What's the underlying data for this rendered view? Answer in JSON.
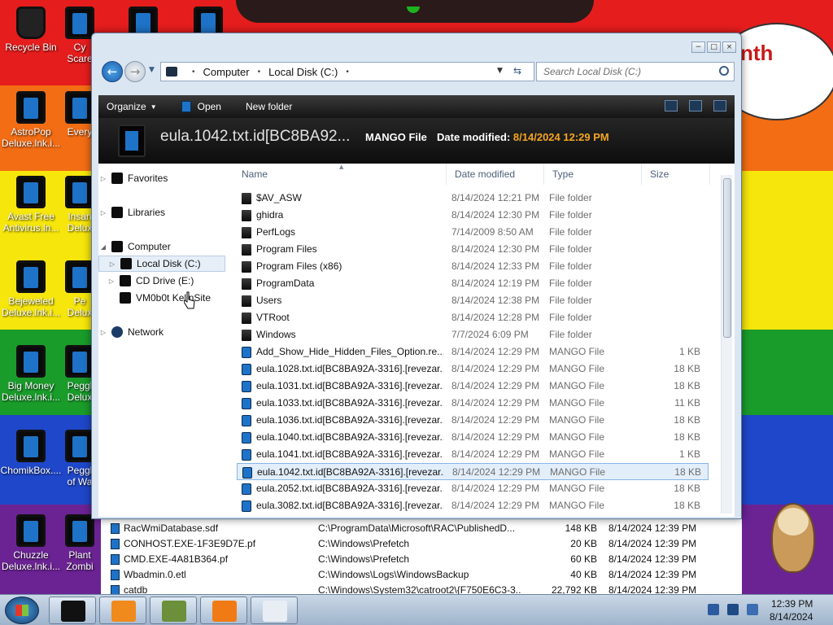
{
  "desktop": {
    "speech_text": "nth",
    "icons": [
      {
        "label": "Recycle Bin"
      },
      {
        "label": "AstroPop Deluxe.lnk.i..."
      },
      {
        "label": "Avast Free Antivirus.ln..."
      },
      {
        "label": "Bejeweled Deluxe.lnk.i..."
      },
      {
        "label": "Big Money Deluxe.lnk.i..."
      },
      {
        "label": "ChomikBox...."
      },
      {
        "label": "Chuzzle Deluxe.lnk.i..."
      },
      {
        "label": "Cy Scare"
      },
      {
        "label": "Every"
      },
      {
        "label": "Insan Delux"
      },
      {
        "label": "Pe Delux"
      },
      {
        "label": "Peggl Delux"
      },
      {
        "label": "Peggl of Wa"
      },
      {
        "label": "Plant Zombi"
      }
    ]
  },
  "window": {
    "controls": {
      "minimize": "−",
      "maximize": "□",
      "close": "×"
    },
    "nav": {
      "back": "←",
      "forward": "→"
    },
    "address": {
      "part1": "Computer",
      "part2": "Local Disk (C:)"
    },
    "search_placeholder": "Search Local Disk (C:)",
    "toolbar": {
      "organize": "Organize",
      "open": "Open",
      "new_folder": "New folder"
    },
    "details": {
      "filename": "eula.1042.txt.id[BC8BA92...",
      "type": "MANGO File",
      "date_label": "Date modified:",
      "date_value": "8/14/2024 12:29 PM"
    },
    "navpane": {
      "favorites": "Favorites",
      "libraries": "Libraries",
      "computer": "Computer",
      "local_disk": "Local Disk (C:)",
      "cd_drive": "CD Drive (E:)",
      "vm_site": "VM0b0t KellnSite",
      "network": "Network"
    },
    "columns": {
      "name": "Name",
      "date": "Date modified",
      "type": "Type",
      "size": "Size"
    },
    "files": [
      {
        "name": "$AV_ASW",
        "date": "8/14/2024 12:21 PM",
        "type": "File folder",
        "size": "",
        "kind": "folder"
      },
      {
        "name": "ghidra",
        "date": "8/14/2024 12:30 PM",
        "type": "File folder",
        "size": "",
        "kind": "folder"
      },
      {
        "name": "PerfLogs",
        "date": "7/14/2009 8:50 AM",
        "type": "File folder",
        "size": "",
        "kind": "folder"
      },
      {
        "name": "Program Files",
        "date": "8/14/2024 12:30 PM",
        "type": "File folder",
        "size": "",
        "kind": "folder"
      },
      {
        "name": "Program Files (x86)",
        "date": "8/14/2024 12:33 PM",
        "type": "File folder",
        "size": "",
        "kind": "folder"
      },
      {
        "name": "ProgramData",
        "date": "8/14/2024 12:19 PM",
        "type": "File folder",
        "size": "",
        "kind": "folder"
      },
      {
        "name": "Users",
        "date": "8/14/2024 12:38 PM",
        "type": "File folder",
        "size": "",
        "kind": "folder"
      },
      {
        "name": "VTRoot",
        "date": "8/14/2024 12:28 PM",
        "type": "File folder",
        "size": "",
        "kind": "folder"
      },
      {
        "name": "Windows",
        "date": "7/7/2024 6:09 PM",
        "type": "File folder",
        "size": "",
        "kind": "folder"
      },
      {
        "name": "Add_Show_Hide_Hidden_Files_Option.re...",
        "date": "8/14/2024 12:29 PM",
        "type": "MANGO File",
        "size": "1 KB",
        "kind": "file"
      },
      {
        "name": "eula.1028.txt.id[BC8BA92A-3316].[revezar...",
        "date": "8/14/2024 12:29 PM",
        "type": "MANGO File",
        "size": "18 KB",
        "kind": "file"
      },
      {
        "name": "eula.1031.txt.id[BC8BA92A-3316].[revezar...",
        "date": "8/14/2024 12:29 PM",
        "type": "MANGO File",
        "size": "18 KB",
        "kind": "file"
      },
      {
        "name": "eula.1033.txt.id[BC8BA92A-3316].[revezar...",
        "date": "8/14/2024 12:29 PM",
        "type": "MANGO File",
        "size": "11 KB",
        "kind": "file"
      },
      {
        "name": "eula.1036.txt.id[BC8BA92A-3316].[revezar...",
        "date": "8/14/2024 12:29 PM",
        "type": "MANGO File",
        "size": "18 KB",
        "kind": "file"
      },
      {
        "name": "eula.1040.txt.id[BC8BA92A-3316].[revezar...",
        "date": "8/14/2024 12:29 PM",
        "type": "MANGO File",
        "size": "18 KB",
        "kind": "file"
      },
      {
        "name": "eula.1041.txt.id[BC8BA92A-3316].[revezar...",
        "date": "8/14/2024 12:29 PM",
        "type": "MANGO File",
        "size": "1 KB",
        "kind": "file"
      },
      {
        "name": "eula.1042.txt.id[BC8BA92A-3316].[revezar...",
        "date": "8/14/2024 12:29 PM",
        "type": "MANGO File",
        "size": "18 KB",
        "kind": "file",
        "selected": true
      },
      {
        "name": "eula.2052.txt.id[BC8BA92A-3316].[revezar...",
        "date": "8/14/2024 12:29 PM",
        "type": "MANGO File",
        "size": "18 KB",
        "kind": "file"
      },
      {
        "name": "eula.3082.txt.id[BC8BA92A-3316].[revezar...",
        "date": "8/14/2024 12:29 PM",
        "type": "MANGO File",
        "size": "18 KB",
        "kind": "file"
      }
    ]
  },
  "bg_list": [
    {
      "name": "RacWmiDatabase.sdf",
      "path": "C:\\ProgramData\\Microsoft\\RAC\\PublishedD...",
      "size": "148 KB",
      "date": "8/14/2024 12:39 PM"
    },
    {
      "name": "CONHOST.EXE-1F3E9D7E.pf",
      "path": "C:\\Windows\\Prefetch",
      "size": "20 KB",
      "date": "8/14/2024 12:39 PM"
    },
    {
      "name": "CMD.EXE-4A81B364.pf",
      "path": "C:\\Windows\\Prefetch",
      "size": "60 KB",
      "date": "8/14/2024 12:39 PM"
    },
    {
      "name": "Wbadmin.0.etl",
      "path": "C:\\Windows\\Logs\\WindowsBackup",
      "size": "40 KB",
      "date": "8/14/2024 12:39 PM"
    },
    {
      "name": "catdb",
      "path": "C:\\Windows\\System32\\catroot2\\{F750E6C3-3...",
      "size": "22,792 KB",
      "date": "8/14/2024 12:39 PM"
    }
  ],
  "taskbar": {
    "time": "12:39 PM",
    "date": "8/14/2024",
    "pinned": [
      {
        "icon": "black-box-icon",
        "color": "#111111"
      },
      {
        "icon": "media-player-icon",
        "color": "#f08a1c"
      },
      {
        "icon": "box-game-icon",
        "color": "#6b8f3a"
      },
      {
        "icon": "magnifier-icon",
        "color": "#f07b14"
      },
      {
        "icon": "document-icon",
        "color": "#e9eef5"
      }
    ]
  }
}
